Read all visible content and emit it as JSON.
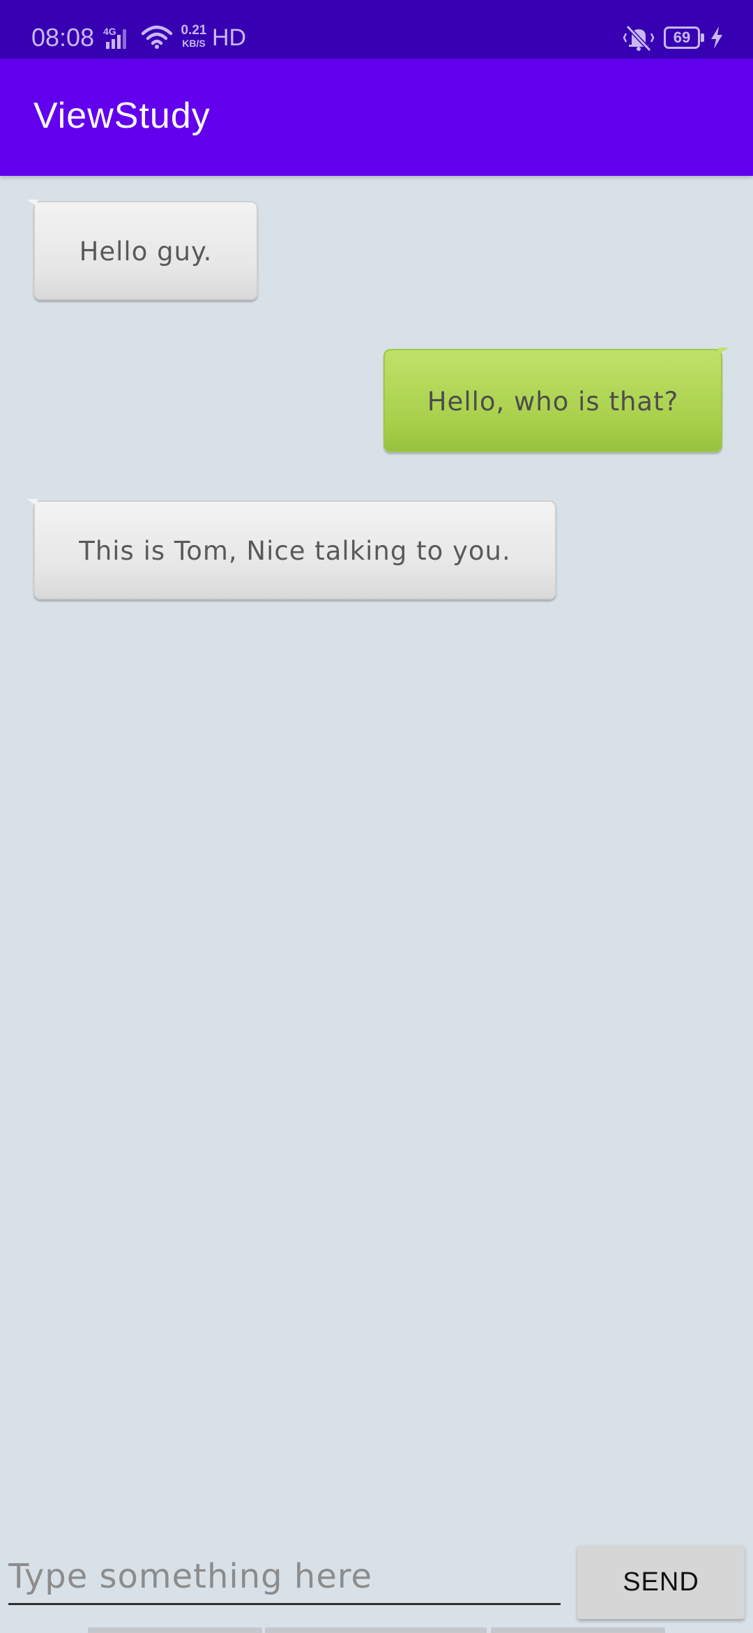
{
  "status_bar": {
    "time": "08:08",
    "network_type": "4G",
    "speed_value": "0.21",
    "speed_unit": "KB/S",
    "hd_label": "HD",
    "battery_level": "69",
    "icons": [
      "signal-icon",
      "wifi-icon",
      "vibrate-off-icon",
      "battery-icon",
      "charging-icon"
    ],
    "color": "#c9b8f5",
    "background": "#3700b3"
  },
  "app_bar": {
    "title": "ViewStudy",
    "background": "#6200ee"
  },
  "chat": {
    "background": "#d9e1e8",
    "messages": [
      {
        "type": "received",
        "text": "Hello guy."
      },
      {
        "type": "sent",
        "text": "Hello, who is that?"
      },
      {
        "type": "received",
        "text": "This is Tom, Nice talking to you."
      }
    ]
  },
  "input_bar": {
    "placeholder": "Type something here",
    "value": "",
    "send_label": "SEND"
  }
}
